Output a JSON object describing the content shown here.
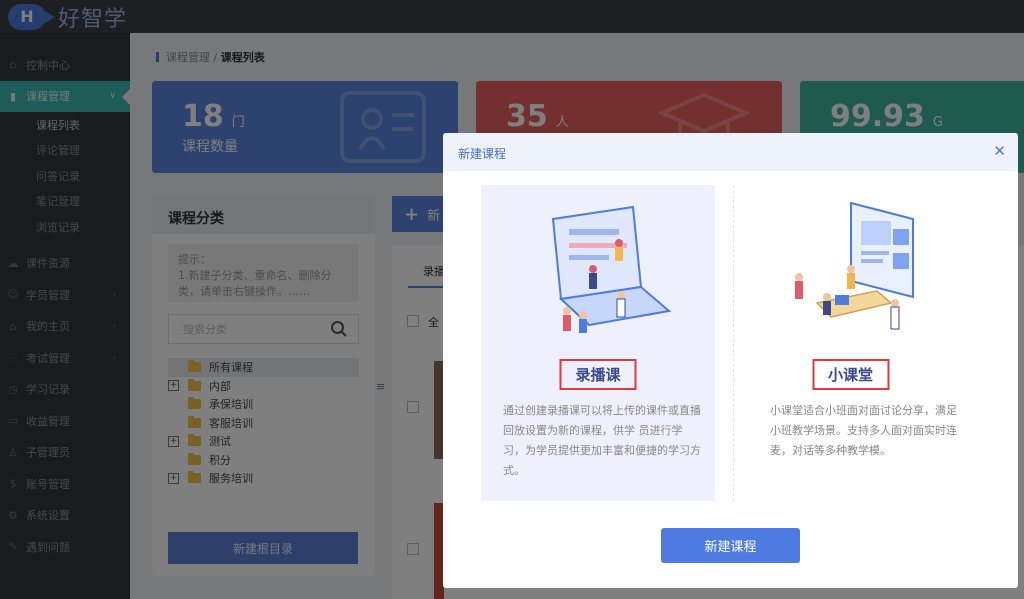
{
  "app": {
    "logo_letter": "H",
    "logo_text": "好智学"
  },
  "sidebar": {
    "items": [
      {
        "label": "控制中心",
        "icon": "home-icon"
      },
      {
        "label": "课程管理",
        "icon": "book-icon",
        "active": true
      },
      {
        "label": "课件资源",
        "icon": "cloud-icon"
      },
      {
        "label": "学员管理",
        "icon": "user-icon"
      },
      {
        "label": "我的主页",
        "icon": "house-icon"
      },
      {
        "label": "考试管理",
        "icon": "exam-icon"
      },
      {
        "label": "学习记录",
        "icon": "record-icon"
      },
      {
        "label": "收益管理",
        "icon": "wallet-icon"
      },
      {
        "label": "子管理员",
        "icon": "admin-icon"
      },
      {
        "label": "账号管理",
        "icon": "dollar-icon"
      },
      {
        "label": "系统设置",
        "icon": "gear-icon"
      },
      {
        "label": "遇到问题",
        "icon": "help-icon"
      }
    ],
    "subitems": [
      "课程列表",
      "评论管理",
      "问答记录",
      "笔记管理",
      "浏览记录"
    ]
  },
  "breadcrumb": {
    "parent": "课程管理",
    "separator": "/",
    "current": "课程列表"
  },
  "stats": [
    {
      "value": "18",
      "unit": "门",
      "label": "课程数量",
      "color": "#5a84dd"
    },
    {
      "value": "35",
      "unit": "人",
      "label": "",
      "color": "#e8605e"
    },
    {
      "value": "99.93",
      "unit": "G",
      "label": "",
      "color": "#3fb59c"
    }
  ],
  "category_panel": {
    "title": "课程分类",
    "tip": "提示：\n1.新建子分类、重命名、删除分类，请单击右键操作。……",
    "search_placeholder": "搜索分类",
    "tree": [
      {
        "label": "所有课程",
        "selected": true,
        "expandable": false,
        "indent": false
      },
      {
        "label": "内部",
        "expandable": true,
        "indent": false
      },
      {
        "label": "承保培训",
        "expandable": false,
        "indent": true
      },
      {
        "label": "客服培训",
        "expandable": false,
        "indent": true
      },
      {
        "label": "测试",
        "expandable": true,
        "indent": false
      },
      {
        "label": "积分",
        "expandable": false,
        "indent": true
      },
      {
        "label": "服务培训",
        "expandable": true,
        "indent": false
      }
    ],
    "new_root_label": "新建根目录"
  },
  "background": {
    "new_btn_fragment": "新",
    "tab_fragment": "录播",
    "select_all_fragment": "全"
  },
  "modal": {
    "title": "新建课程",
    "options": [
      {
        "title": "录播课",
        "desc": "通过创建录播课可以将上传的课件或直播回放设置为新的课程，供学 员进行学习，为学员提供更加丰富和便捷的学习方式。",
        "selected": true
      },
      {
        "title": "小课堂",
        "desc": "小课堂适合小班面对面讨论分享，满足小班教学场景。支持多人面对面实时连麦，对话等多种教学模。",
        "selected": false
      }
    ],
    "create_button": "新建课程"
  }
}
